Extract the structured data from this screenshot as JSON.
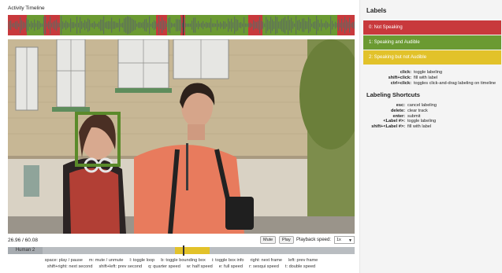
{
  "timeline": {
    "title": "Activity Timeline",
    "colors": {
      "not_speaking": "#c8393c",
      "speaking": "#6b9a32",
      "waveform": "#5d6b62"
    }
  },
  "controls": {
    "time": "26.96 / 60.08",
    "mute_label": "Mute",
    "play_label": "Play",
    "speed_label": "Playback speed:",
    "speed_value": "1x"
  },
  "track": {
    "name": "Human 2",
    "colors": {
      "active": "#e2c22a",
      "inactive": "#b9bdc1"
    }
  },
  "shortcuts_bar": {
    "row1": [
      "space: play / pause",
      "m: mute / unmute",
      "l: toggle loop",
      "b: toggle bounding box",
      "i: toggle box info",
      "right: next frame",
      "left: prev frame"
    ],
    "row2": [
      "shift+right: next second",
      "shift+left: prev second",
      "q: quarter speed",
      "w: half speed",
      "e: full speed",
      "r: sesqui speed",
      "t: double speed"
    ]
  },
  "sidebar": {
    "labels_title": "Labels",
    "labels": [
      {
        "text": "0: Not Speaking",
        "color": "#c8393c"
      },
      {
        "text": "1: Speaking and Audible",
        "color": "#6b9a32"
      },
      {
        "text": "2: Speaking but not Audible",
        "color": "#e2c22a"
      }
    ],
    "mouse_help": [
      {
        "key": "click:",
        "desc": "toggle labeling"
      },
      {
        "key": "shift+click:",
        "desc": "fill with label"
      },
      {
        "key": "ctrl+click:",
        "desc": "toggles click-and-drag labeling on timeline"
      }
    ],
    "shortcuts_title": "Labeling Shortcuts",
    "shortcut_help": [
      {
        "key": "esc:",
        "desc": "cancel labeling"
      },
      {
        "key": "delete:",
        "desc": "clear track"
      },
      {
        "key": "enter:",
        "desc": "submit"
      },
      {
        "key": "<Label #>:",
        "desc": "toggle labeling"
      },
      {
        "key": "shift+<Label #>:",
        "desc": "fill with label"
      }
    ]
  }
}
